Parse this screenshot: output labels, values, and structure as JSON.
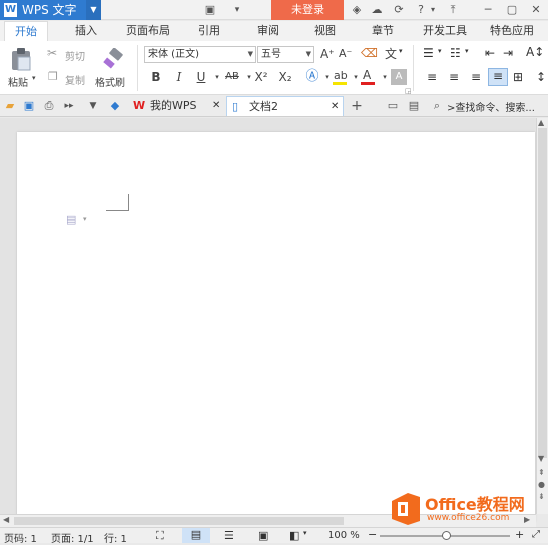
{
  "app": {
    "name": "WPS 文字",
    "logo_letter": "W"
  },
  "titlebar": {
    "login_label": "未登录"
  },
  "menu_tabs": [
    {
      "label": "开始",
      "active": true
    },
    {
      "label": "插入"
    },
    {
      "label": "页面布局"
    },
    {
      "label": "引用"
    },
    {
      "label": "审阅"
    },
    {
      "label": "视图"
    },
    {
      "label": "章节"
    },
    {
      "label": "开发工具"
    },
    {
      "label": "特色应用"
    }
  ],
  "ribbon": {
    "paste_label": "粘贴",
    "cut_label": "剪切",
    "copy_label": "复制",
    "format_painter_label": "格式刷",
    "font_name": "宋体 (正文)",
    "font_size": "五号",
    "bold": "B",
    "italic": "I",
    "underline": "U",
    "strikethrough": "AB",
    "superscript": "X²",
    "subscript": "X₂",
    "grow_font": "A⁺",
    "shrink_font": "A⁻",
    "accent_color": "#2f7bd0",
    "font_color": "#e02020",
    "highlight_color": "#f5e400"
  },
  "quickbar": {
    "tabs": [
      {
        "label": "我的WPS"
      },
      {
        "label": "文档2",
        "active": true
      }
    ],
    "search_placeholder": ">查找命令、搜索..."
  },
  "status": {
    "page_no": "页码: 1",
    "page_count": "页面: 1/1",
    "line": "行: 1",
    "zoom": "100 %"
  },
  "watermark": {
    "brand": "Office教程网",
    "url": "www.office26.com",
    "brand_color": "#f26b1d"
  }
}
